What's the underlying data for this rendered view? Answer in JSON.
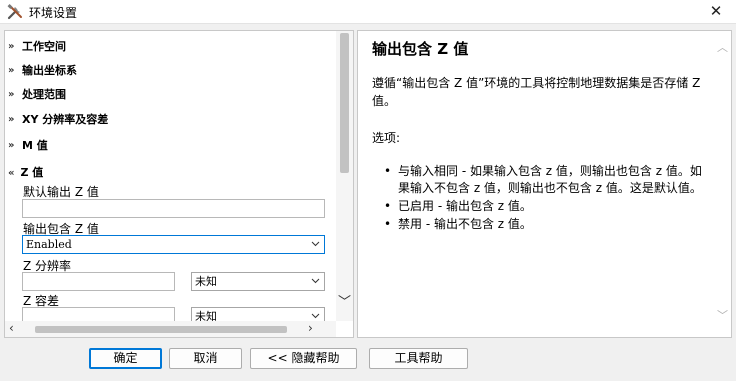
{
  "window": {
    "title": "环境设置",
    "close_icon": "close-icon",
    "app_icon": "tools-icon"
  },
  "left": {
    "sections": [
      {
        "label": "工作空间",
        "state": "collapsed"
      },
      {
        "label": "输出坐标系",
        "state": "collapsed"
      },
      {
        "label": "处理范围",
        "state": "collapsed"
      },
      {
        "label": "XY 分辨率及容差",
        "state": "collapsed"
      },
      {
        "label": "M 值",
        "state": "collapsed"
      },
      {
        "label": "Z 值",
        "state": "expanded"
      }
    ],
    "z_fields": {
      "default_output_z_label": "默认输出 Z 值",
      "default_output_z_value": "",
      "output_has_z_label": "输出包含 Z 值",
      "output_has_z_value": "Enabled",
      "z_resolution_label": "Z 分辨率",
      "z_resolution_value": "",
      "z_resolution_unit": "未知",
      "z_tolerance_label": "Z 容差",
      "z_tolerance_value": "",
      "z_tolerance_unit": "未知"
    }
  },
  "help": {
    "title": "输出包含 Z 值",
    "description": "遵循“输出包含 Z 值”环境的工具将控制地理数据集是否存储 Z 值。",
    "options_label": "选项:",
    "options": [
      "与输入相同 - 如果输入包含 z 值，则输出也包含 z 值。如果输入不包含 z 值，则输出也不包含 z 值。这是默认值。",
      "已启用 - 输出包含 z 值。",
      "禁用 - 输出不包含 z 值。"
    ]
  },
  "buttons": {
    "ok": "确定",
    "cancel": "取消",
    "hide_help": "<< 隐藏帮助",
    "tool_help": "工具帮助"
  },
  "colors": {
    "focus_border": "#0078d7",
    "window_bg": "#f0f0f0"
  }
}
